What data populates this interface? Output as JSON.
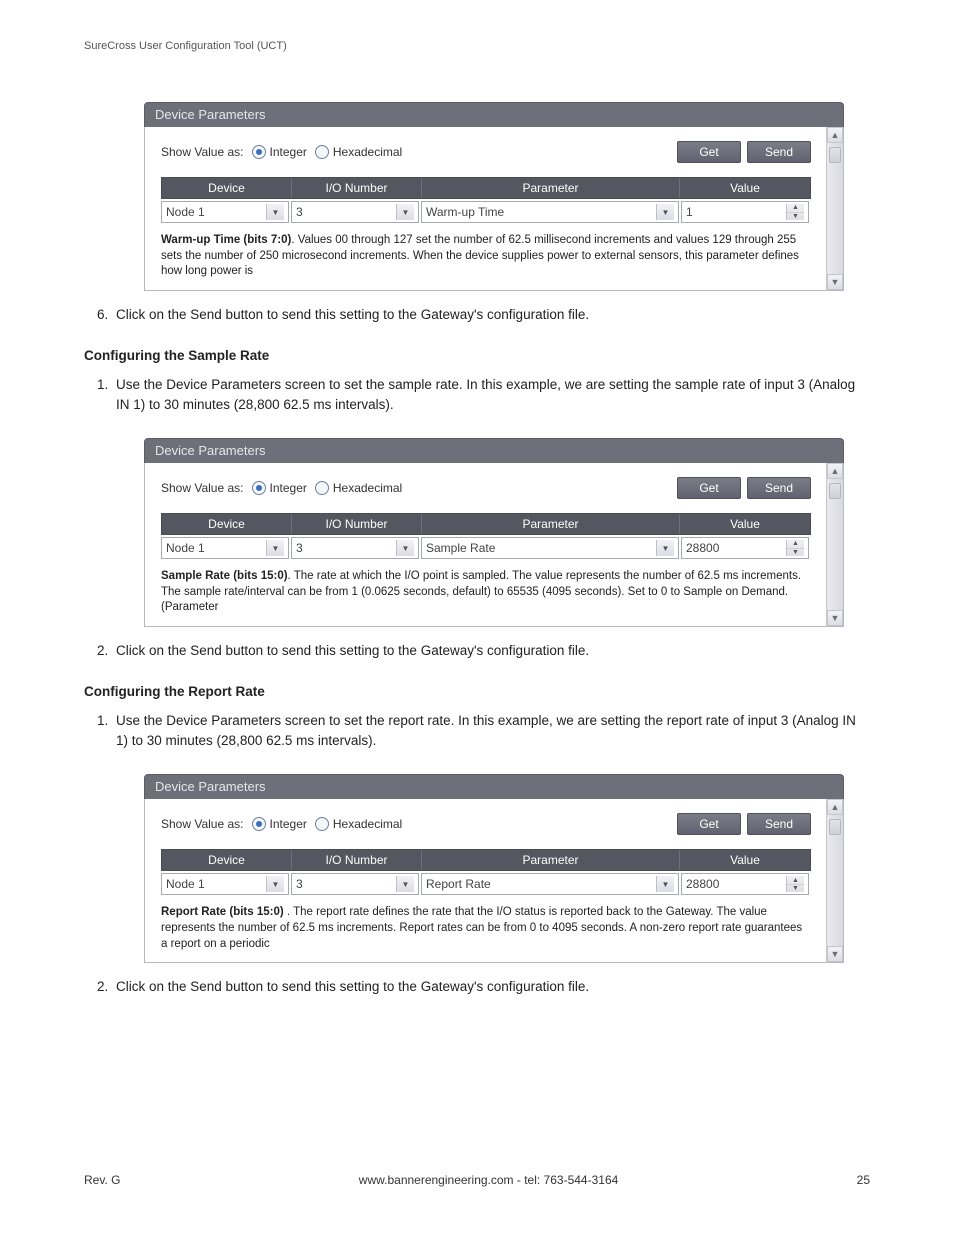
{
  "doc_header": "SureCross User Configuration Tool (UCT)",
  "step6": "Click on the Send button to send this setting to the Gateway's configuration file.",
  "sample_heading": "Configuring the Sample Rate",
  "sample_step1": "Use the Device Parameters screen to set the sample rate. In this example, we are setting the sample rate of input 3 (Analog IN 1) to 30 minutes (28,800 62.5 ms intervals).",
  "sample_step2": "Click on the Send button to send this setting to the Gateway's configuration file.",
  "report_heading": "Configuring the Report Rate",
  "report_step1": "Use the Device Parameters screen to set the report rate. In this example, we are setting the report rate of input 3 (Analog IN 1) to 30 minutes (28,800 62.5 ms intervals).",
  "report_step2": "Click on the Send button to send this setting to the Gateway's configuration file.",
  "panel": {
    "title": "Device Parameters",
    "show_value_label": "Show Value as:",
    "radio_integer": "Integer",
    "radio_hex": "Hexadecimal",
    "btn_get": "Get",
    "btn_send": "Send",
    "col_device": "Device",
    "col_io": "I/O Number",
    "col_param": "Parameter",
    "col_value": "Value"
  },
  "panel1": {
    "device": "Node 1",
    "io": "3",
    "param": "Warm-up Time",
    "value": "1",
    "desc_bold": "Warm-up Time (bits 7:0)",
    "desc_rest": ". Values 00 through 127 set the number of 62.5 millisecond increments and values 129 through 255 sets the number of 250 microsecond increments. When the device supplies power to external sensors, this parameter defines how long power is"
  },
  "panel2": {
    "device": "Node 1",
    "io": "3",
    "param": "Sample Rate",
    "value": "28800",
    "desc_bold": "Sample Rate (bits 15:0)",
    "desc_rest": ". The rate at which the I/O point is sampled. The value represents the number of 62.5 ms increments. The sample rate/interval can be from 1 (0.0625 seconds, default) to 65535 (4095 seconds). Set to 0 to Sample on Demand. (Parameter"
  },
  "panel3": {
    "device": "Node 1",
    "io": "3",
    "param": "Report Rate",
    "value": "28800",
    "desc_bold": "Report Rate (bits 15:0)",
    "desc_rest": " . The report rate defines the rate that the I/O status is reported back to the Gateway. The value represents the number of 62.5 ms increments. Report rates can be from 0 to 4095 seconds. A non-zero report rate guarantees a report on a periodic"
  },
  "footer": {
    "rev": "Rev. G",
    "center": "www.bannerengineering.com - tel: 763-544-3164",
    "page": "25"
  }
}
